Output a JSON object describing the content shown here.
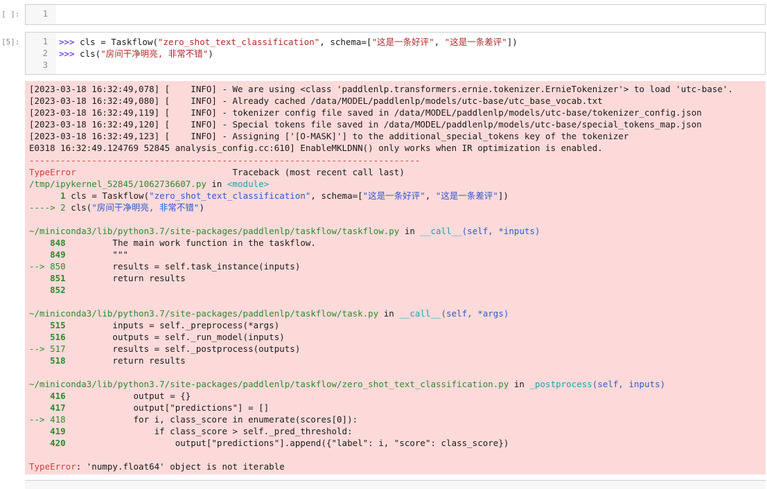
{
  "cells": {
    "empty": {
      "prompt": "[ ]:",
      "line_numbers": [
        "1"
      ]
    },
    "code": {
      "prompt": "[5]:",
      "line_numbers": [
        "1",
        "2",
        "3"
      ],
      "lines": [
        {
          "p": ">>> ",
          "a": "cls = Taskflow(",
          "s1": "\"zero_shot_text_classification\"",
          "b": ", schema=[",
          "s2": "\"这是一条好评\"",
          "c": ", ",
          "s3": "\"这是一条差评\"",
          "d": "])"
        },
        {
          "p": ">>> ",
          "a": "cls(",
          "s1": "\"房间干净明亮, 非常不错\"",
          "b": ")"
        }
      ]
    }
  },
  "output": {
    "log_lines": [
      "[2023-03-18 16:32:49,078] [    INFO] - We are using <class 'paddlenlp.transformers.ernie.tokenizer.ErnieTokenizer'> to load 'utc-base'.",
      "[2023-03-18 16:32:49,080] [    INFO] - Already cached /data/MODEL/paddlenlp/models/utc-base/utc_base_vocab.txt",
      "[2023-03-18 16:32:49,119] [    INFO] - tokenizer config file saved in /data/MODEL/paddlenlp/models/utc-base/tokenizer_config.json",
      "[2023-03-18 16:32:49,120] [    INFO] - Special tokens file saved in /data/MODEL/paddlenlp/models/utc-base/special_tokens_map.json",
      "[2023-03-18 16:32:49,123] [    INFO] - Assigning ['[O-MASK]'] to the additional_special_tokens key of the tokenizer",
      "E0318 16:32:49.124769 52845 analysis_config.cc:610] EnableMKLDNN() only works when IR optimization is enabled."
    ],
    "separator": "---------------------------------------------------------------------------",
    "tb_header_type": "TypeError",
    "tb_header_text": "Traceback (most recent call last)",
    "frame0_file": "/tmp/ipykernel_52845/1062736607.py",
    "frame0_in": " in ",
    "frame0_func": "<module>",
    "frame0_l1_num": "      1",
    "frame0_l1_code_a": " cls = Taskflow(",
    "frame0_l1_s1": "\"zero_shot_text_classification\"",
    "frame0_l1_code_b": ", schema=[",
    "frame0_l1_s2": "\"这是一条好评\"",
    "frame0_l1_code_c": ", ",
    "frame0_l1_s3": "\"这是一条差评\"",
    "frame0_l1_code_d": "])",
    "frame0_l2_arrow": "----> 2",
    "frame0_l2_code_a": " cls(",
    "frame0_l2_s1": "\"房间干净明亮, 非常不错\"",
    "frame0_l2_code_b": ")",
    "frame1_file": "~/miniconda3/lib/python3.7/site-packages/paddlenlp/taskflow/taskflow.py",
    "frame1_in": " in ",
    "frame1_func": "__call__",
    "frame1_args": "(self, *inputs)",
    "frame1_lines": [
      {
        "num": "    848",
        "code": "         The main work function in the taskflow."
      },
      {
        "num": "    849",
        "code": "         \"\"\""
      },
      {
        "num": "--> 850",
        "code": "         results = self.task_instance(inputs)"
      },
      {
        "num": "    851",
        "code": "         return results"
      },
      {
        "num": "    852",
        "code": ""
      }
    ],
    "frame2_file": "~/miniconda3/lib/python3.7/site-packages/paddlenlp/taskflow/task.py",
    "frame2_in": " in ",
    "frame2_func": "__call__",
    "frame2_args": "(self, *args)",
    "frame2_lines": [
      {
        "num": "    515",
        "code": "         inputs = self._preprocess(*args)"
      },
      {
        "num": "    516",
        "code": "         outputs = self._run_model(inputs)"
      },
      {
        "num": "--> 517",
        "code": "         results = self._postprocess(outputs)"
      },
      {
        "num": "    518",
        "code": "         return results"
      }
    ],
    "frame3_file": "~/miniconda3/lib/python3.7/site-packages/paddlenlp/taskflow/zero_shot_text_classification.py",
    "frame3_in": " in ",
    "frame3_func": "_postprocess",
    "frame3_args": "(self, inputs)",
    "frame3_lines": [
      {
        "num": "    416",
        "code": "             output = {}"
      },
      {
        "num": "    417",
        "code": "             output[\"predictions\"] = []"
      },
      {
        "num": "--> 418",
        "code": "             for i, class_score in enumerate(scores[0]):"
      },
      {
        "num": "    419",
        "code": "                 if class_score > self._pred_threshold:"
      },
      {
        "num": "    420",
        "code": "                     output[\"predictions\"].append({\"label\": i, \"score\": class_score})"
      }
    ],
    "final_type": "TypeError",
    "final_msg": ": 'numpy.float64' object is not iterable"
  }
}
